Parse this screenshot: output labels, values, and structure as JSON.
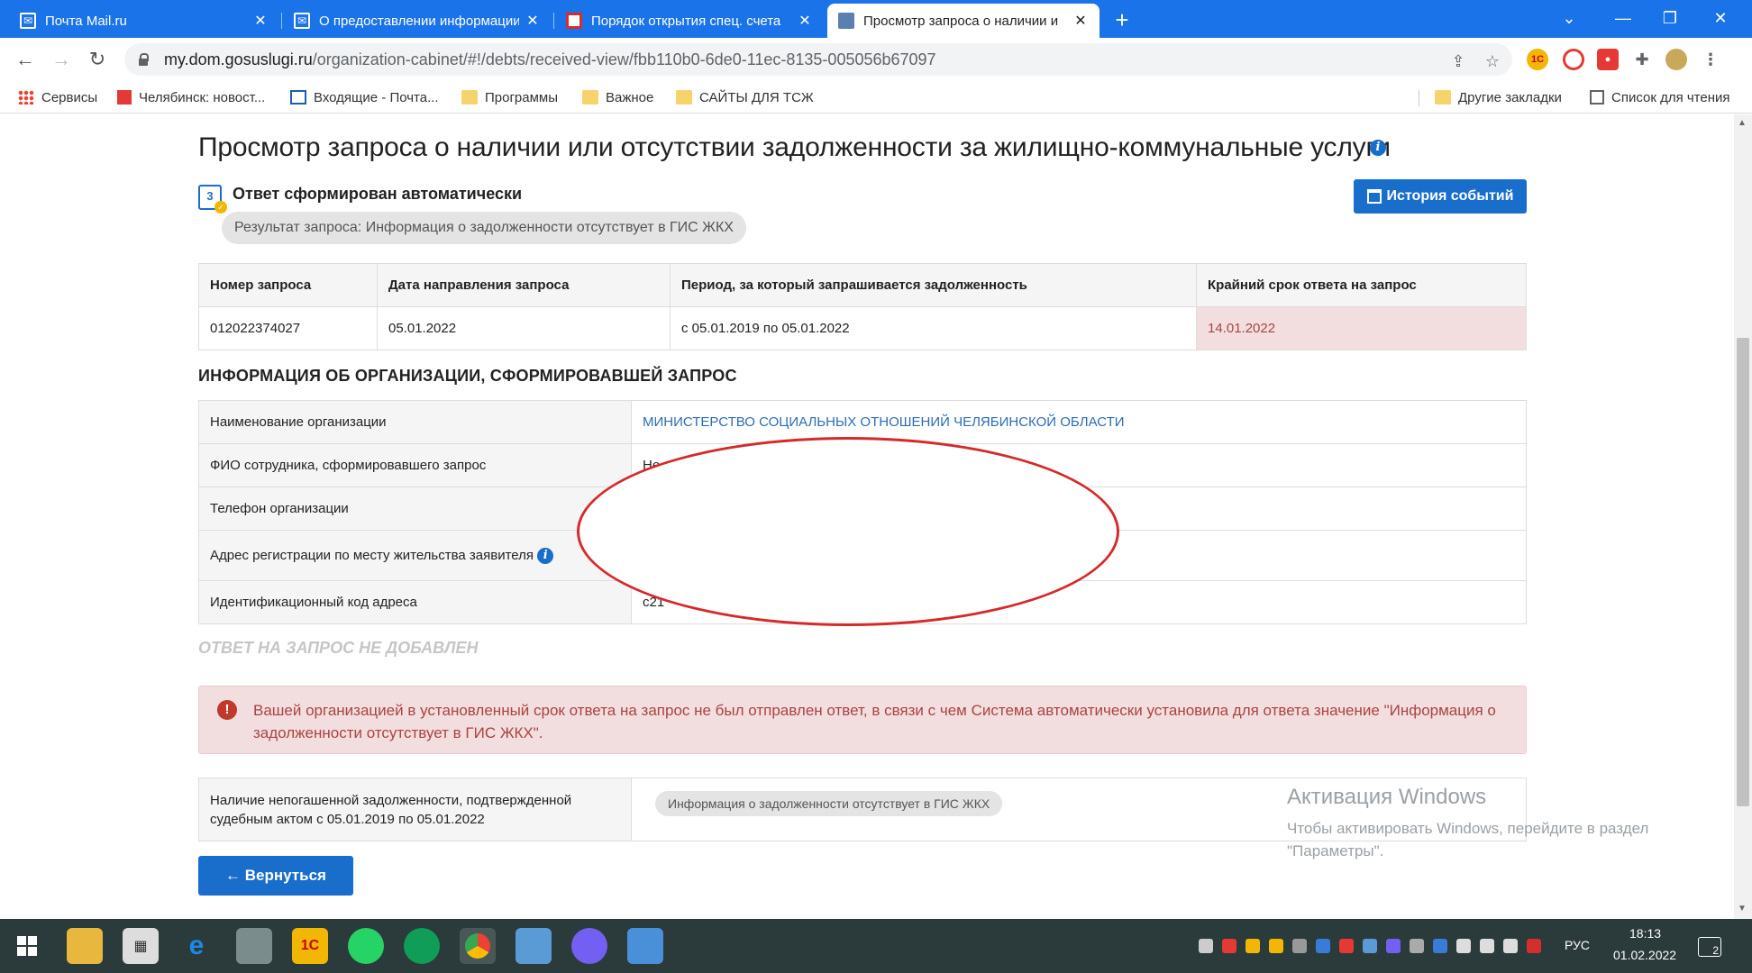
{
  "browser": {
    "tabs": [
      {
        "title": "Почта Mail.ru",
        "icon": "mail-icon"
      },
      {
        "title": "О предоставлении информации",
        "icon": "mail-icon"
      },
      {
        "title": "Порядок открытия спец. счета",
        "icon": "red-square-icon"
      },
      {
        "title": "Просмотр запроса о наличии и",
        "icon": "document-icon"
      }
    ],
    "url_host": "my.dom.gosuslugi.ru",
    "url_path": "/organization-cabinet/#!/debts/received-view/fbb110b0-6de0-11ec-8135-005056b67097",
    "bookmarks": [
      {
        "label": "Сервисы",
        "icon": "apps-icon"
      },
      {
        "label": "Челябинск: новост...",
        "icon": "news-icon"
      },
      {
        "label": "Входящие - Почта...",
        "icon": "mail-icon"
      },
      {
        "label": "Программы",
        "icon": "folder-icon"
      },
      {
        "label": "Важное",
        "icon": "folder-icon"
      },
      {
        "label": "САЙТЫ ДЛЯ ТСЖ",
        "icon": "folder-icon"
      }
    ],
    "other_bookmarks": "Другие закладки",
    "reading_list": "Список для чтения"
  },
  "page": {
    "title": "Просмотр запроса о наличии или отсутствии задолженности за жилищно-коммунальные услуги",
    "auto_label": "Ответ сформирован автоматически",
    "result_pill": "Результат запроса: Информация о задолженности отсутствует в ГИС ЖКХ",
    "history_button": "История событий",
    "request_table": {
      "headers": [
        "Номер запроса",
        "Дата направления запроса",
        "Период, за который запрашивается задолженность",
        "Крайний срок ответа на запрос"
      ],
      "row": [
        "012022374027",
        "05.01.2022",
        "с 05.01.2019 по 05.01.2022",
        "14.01.2022"
      ]
    },
    "org_section_title": "ИНФОРМАЦИЯ ОБ ОРГАНИЗАЦИИ, СФОРМИРОВАВШЕЙ ЗАПРОС",
    "org_rows": [
      {
        "label": "Наименование организации",
        "value": "МИНИСТЕРСТВО СОЦИАЛЬНЫХ ОТНОШЕНИЙ ЧЕЛЯБИНСКОЙ ОБЛАСТИ"
      },
      {
        "label": "ФИО сотрудника, сформировавшего запрос",
        "value": "Не"
      },
      {
        "label": "Телефон организации",
        "value": ""
      },
      {
        "label": "Адрес регистрации по месту жительства заявителя",
        "value": ""
      },
      {
        "label": "Идентификационный код адреса",
        "value": "c21"
      }
    ],
    "no_answer": "ОТВЕТ НА ЗАПРОС НЕ ДОБАВЛЕН",
    "alert_text": "Вашей организацией в установленный срок ответа на запрос не был отправлен ответ, в связи с чем Система автоматически установила для ответа значение \"Информация о задолженности отсутствует в ГИС ЖКХ\".",
    "debt_label": "Наличие непогашенной задолженности, подтвержденной судебным актом с 05.01.2019 по 05.01.2022",
    "debt_value": "Информация о задолженности отсутствует в ГИС ЖКХ",
    "back_button": "← Вернуться"
  },
  "watermark": {
    "title": "Активация Windows",
    "text": "Чтобы активировать Windows, перейдите в раздел \"Параметры\"."
  },
  "taskbar": {
    "language": "РУС",
    "time": "18:13",
    "date": "01.02.2022",
    "notifications": "2"
  },
  "colors": {
    "chrome_blue": "#1a73e8",
    "primary_button": "#1a6ecb",
    "overdue_bg": "#f2dede",
    "overdue_text": "#a94442",
    "redaction_ellipse": "#d52a2a"
  }
}
